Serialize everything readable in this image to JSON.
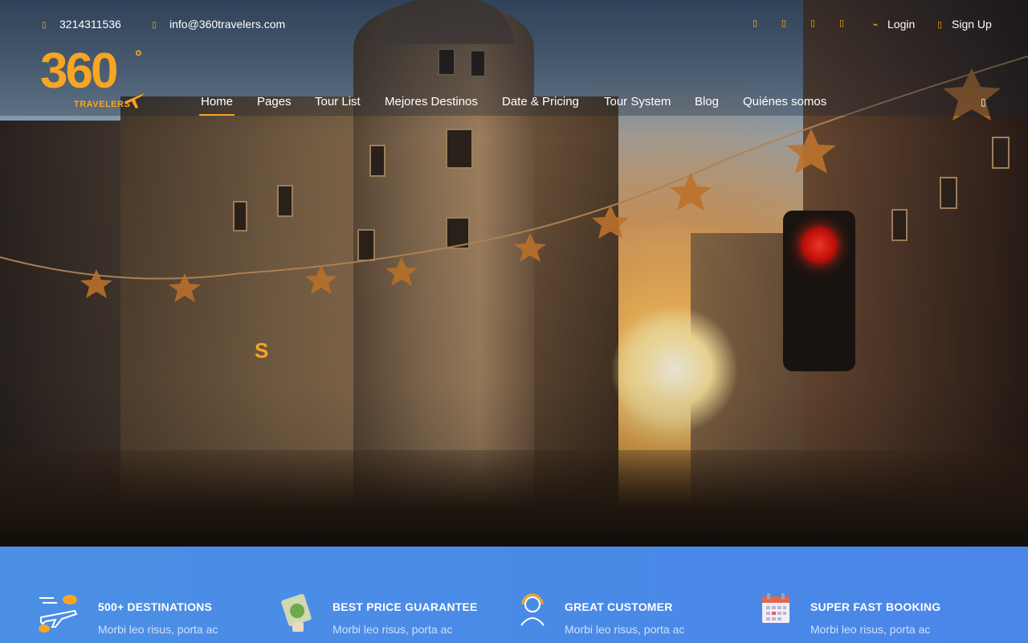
{
  "topbar": {
    "phone": "3214311536",
    "email": "info@360travelers.com",
    "social_icons": [
      "facebook-icon",
      "twitter-icon",
      "instagram-icon",
      "youtube-icon"
    ],
    "login_label": "Login",
    "signup_label": "Sign Up"
  },
  "logo": {
    "number": "360",
    "degree": "°",
    "tagline": "TRAVELERS"
  },
  "nav": {
    "items": [
      {
        "label": "Home",
        "active": true
      },
      {
        "label": "Pages"
      },
      {
        "label": "Tour List"
      },
      {
        "label": "Mejores Destinos"
      },
      {
        "label": "Date & Pricing"
      },
      {
        "label": "Tour System"
      },
      {
        "label": "Blog"
      },
      {
        "label": "Quiénes somos"
      }
    ],
    "search_icon": "search-icon"
  },
  "hero": {
    "overlay_text": "S"
  },
  "features": [
    {
      "icon": "plane-icon",
      "title": "500+ DESTINATIONS",
      "desc": "Morbi leo risus, porta ac"
    },
    {
      "icon": "money-icon",
      "title": "BEST PRICE GUARANTEE",
      "desc": "Morbi leo risus, porta ac"
    },
    {
      "icon": "support-agent-icon",
      "title": "GREAT CUSTOMER",
      "desc": "Morbi leo risus, porta ac"
    },
    {
      "icon": "calendar-icon",
      "title": "SUPER FAST BOOKING",
      "desc": "Morbi leo risus, porta ac"
    }
  ],
  "colors": {
    "accent": "#f5a623",
    "feature_band": "#4a86e8",
    "nav_text": "#ffffff"
  }
}
